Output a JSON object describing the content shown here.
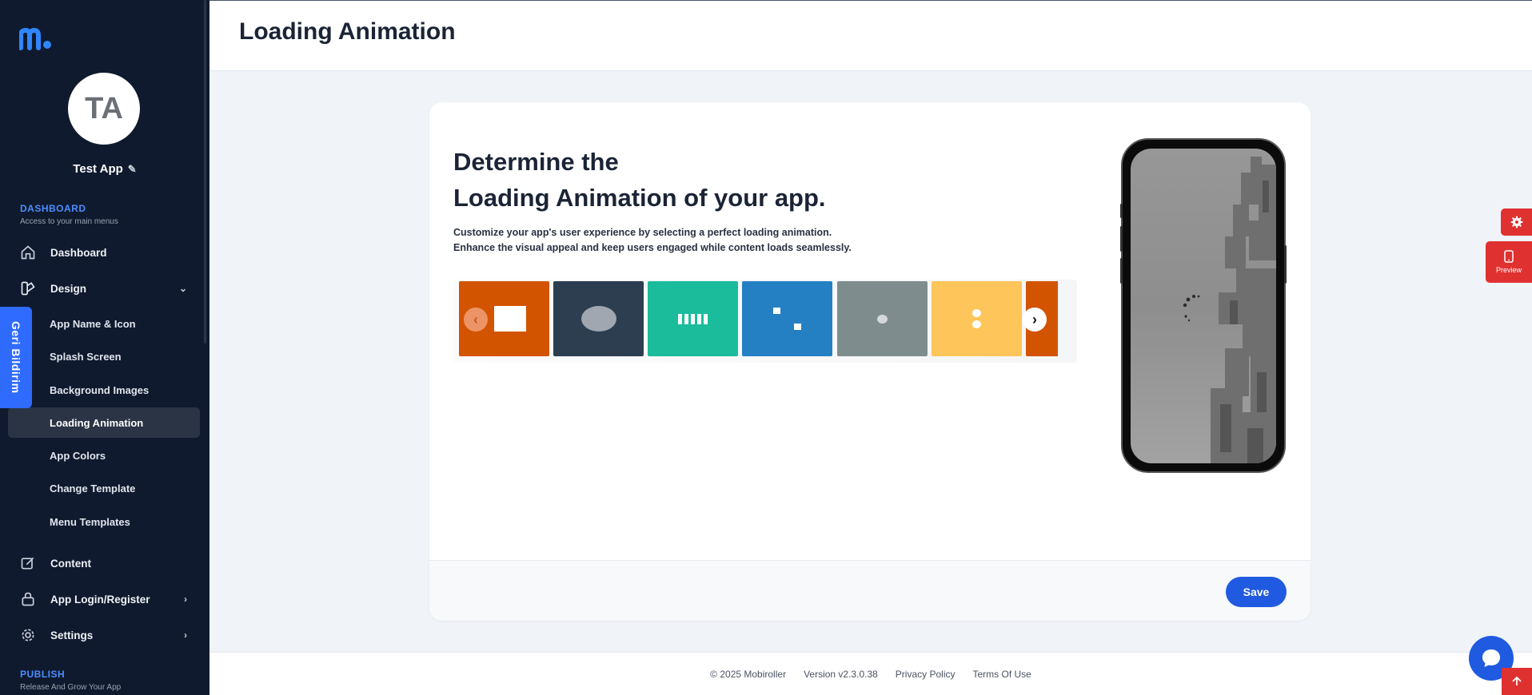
{
  "brand": {
    "primary": "#1f5ae0",
    "sidebar_bg": "#0f1a2e",
    "danger": "#e03131"
  },
  "sidebar": {
    "avatar_initials": "TA",
    "app_name": "Test App",
    "dashboard_section": {
      "title": "DASHBOARD",
      "subtitle": "Access to your main menus"
    },
    "items": {
      "dashboard": "Dashboard",
      "design": "Design",
      "content": "Content",
      "login": "App Login/Register",
      "settings": "Settings"
    },
    "design_subitems": [
      "App Name & Icon",
      "Splash Screen",
      "Background Images",
      "Loading Animation",
      "App Colors",
      "Change Template",
      "Menu Templates"
    ],
    "active_subitem": "Loading Animation",
    "publish_section": {
      "title": "PUBLISH",
      "subtitle": "Release And Grow Your App"
    }
  },
  "feedback_tab": "Geri Bildirim",
  "header": {
    "title": "Loading Animation"
  },
  "card": {
    "heading_line1": "Determine the",
    "heading_line2": "Loading Animation of your app.",
    "desc_line1": "Customize your app's user experience by selecting a perfect loading animation.",
    "desc_line2": "Enhance the visual appeal and keep users engaged while content loads seamlessly.",
    "tiles": [
      {
        "color": "#d35400",
        "icon": "square-icon"
      },
      {
        "color": "#2c3e50",
        "icon": "ellipse-icon"
      },
      {
        "color": "#1abc9c",
        "icon": "bars-icon"
      },
      {
        "color": "#2580c3",
        "icon": "two-squares-icon"
      },
      {
        "color": "#7f8c8d",
        "icon": "dot-icon"
      },
      {
        "color": "#fec55a",
        "icon": "two-dots-icon"
      },
      {
        "color": "#d35400",
        "icon": "partial-tile"
      }
    ],
    "prev_arrow": "‹",
    "next_arrow": "›",
    "save_label": "Save"
  },
  "preview_label": "Preview",
  "footer": {
    "copyright": "© 2025 Mobiroller",
    "version": "Version v2.3.0.38",
    "privacy": "Privacy Policy",
    "terms": "Terms Of Use"
  }
}
